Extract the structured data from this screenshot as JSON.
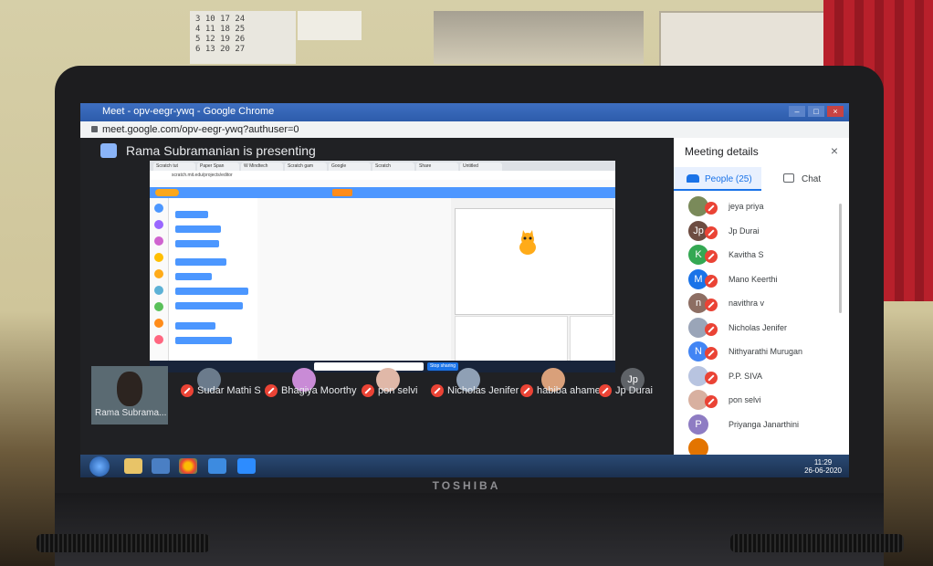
{
  "browser": {
    "window_title": "Meet - opv-eegr-ywq - Google Chrome",
    "url": "meet.google.com/opv-eegr-ywq?authuser=0",
    "controls": [
      "–",
      "□",
      "×"
    ]
  },
  "meet": {
    "presenting_text": "Rama Subramanian is presenting",
    "self_label": "Rama Subrama...",
    "tiles": [
      {
        "name": "Sudar Mathi S",
        "avatar_color": "#6b7b8c"
      },
      {
        "name": "Bhagiya Moorthy",
        "avatar_color": "#c98bd6"
      },
      {
        "name": "pon selvi",
        "avatar_color": "#e0b8a8"
      },
      {
        "name": "Nicholas Jenifer",
        "avatar_color": "#8fa0b5"
      },
      {
        "name": "habiba ahamed",
        "avatar_color": "#d9a07a"
      },
      {
        "name": "Jp Durai",
        "avatar_color": "#5f6368",
        "initials": "Jp"
      }
    ]
  },
  "shared_screen": {
    "tabs": [
      "Scratch tut",
      "Paper Span",
      "W Mindtech",
      "Scratch gam",
      "Google",
      "Scratch",
      "Share",
      "Untitled"
    ],
    "address": "scratch.mit.edu/projects/editor",
    "stop_sharing": "Stop sharing"
  },
  "panel": {
    "title": "Meeting details",
    "close": "×",
    "people_tab": "People (25)",
    "chat_tab": "Chat",
    "people": [
      {
        "name": "jeya priya",
        "initial": "",
        "color": "#7a8a5a"
      },
      {
        "name": "Jp Durai",
        "initial": "Jp",
        "color": "#6d4c41"
      },
      {
        "name": "Kavitha S",
        "initial": "K",
        "color": "#34a853"
      },
      {
        "name": "Mano Keerthi",
        "initial": "M",
        "color": "#1a73e8"
      },
      {
        "name": "navithra v",
        "initial": "n",
        "color": "#8d6e63"
      },
      {
        "name": "Nicholas Jenifer",
        "initial": "",
        "color": "#9aa5b8"
      },
      {
        "name": "Nithyarathi Murugan",
        "initial": "N",
        "color": "#4285f4"
      },
      {
        "name": "P.P. SIVA",
        "initial": "",
        "color": "#b8c4e0"
      },
      {
        "name": "pon selvi",
        "initial": "",
        "color": "#d8b0a0"
      },
      {
        "name": "Priyanga Janarthini",
        "initial": "P",
        "color": "#8e7cc3"
      },
      {
        "name": "",
        "initial": "",
        "color": "#e37400"
      }
    ]
  },
  "taskbar": {
    "clock_time": "11:29",
    "clock_date": "26-06-2020"
  },
  "room": {
    "calendar_text": "3 10 17 24\n4 11 18 25\n5 12 19 26\n6 13 20 27",
    "laptop_brand": "TOSHIBA"
  }
}
